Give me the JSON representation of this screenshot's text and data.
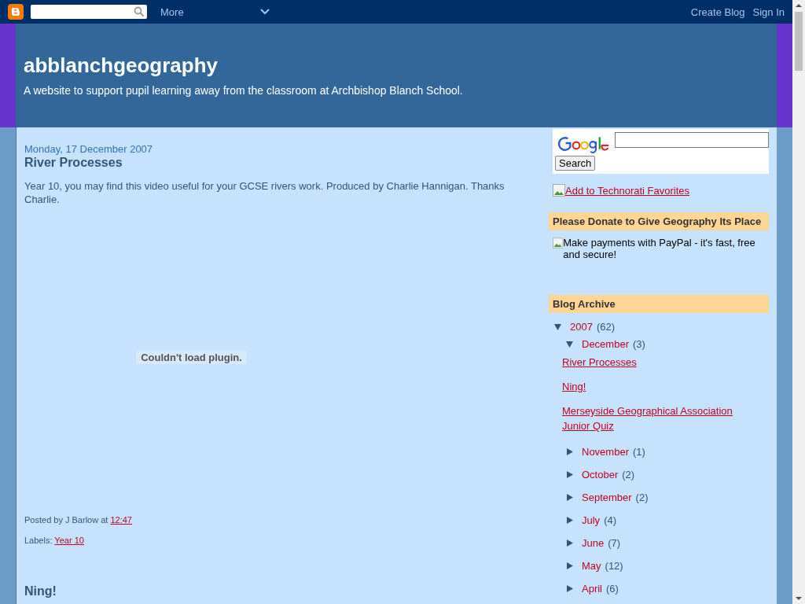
{
  "navbar": {
    "more_label": "More",
    "links": [
      "Create Blog",
      "Sign In"
    ]
  },
  "header": {
    "title": "abblanchgeography",
    "description": "A website to support pupil learning away from the classroom at Archbishop Blanch School."
  },
  "posts": [
    {
      "date": "Monday, 17 December 2007",
      "title": "River Processes",
      "body": "Year 10, you may find this video useful for your GCSE rivers work. Produced by Charlie Hannigan. Thanks Charlie.",
      "plugin_message": "Couldn't load plugin.",
      "posted_by": "Posted by J Barlow at",
      "time": "12:47",
      "labels_label": "Labels:",
      "labels": [
        "Year 10"
      ]
    },
    {
      "title": "Ning!"
    }
  ],
  "sidebar": {
    "search_button": "Search",
    "technorati_link": "Add to Technorati Favorites",
    "donate": {
      "title": "Please Donate to Give Geography Its Place",
      "image_alt": "Make payments with PayPal - it's fast, free and secure!"
    },
    "archive": {
      "title": "Blog Archive",
      "items": [
        {
          "label": "2007",
          "count": "(62)",
          "expanded": true,
          "children": [
            {
              "label": "December",
              "count": "(3)",
              "expanded": true,
              "posts": [
                "River Processes",
                "Ning!",
                "Merseyside Geographical Association Junior Quiz"
              ]
            },
            {
              "label": "November",
              "count": "(1)",
              "expanded": false
            },
            {
              "label": "October",
              "count": "(2)",
              "expanded": false
            },
            {
              "label": "September",
              "count": "(2)",
              "expanded": false
            },
            {
              "label": "July",
              "count": "(4)",
              "expanded": false
            },
            {
              "label": "June",
              "count": "(7)",
              "expanded": false
            },
            {
              "label": "May",
              "count": "(12)",
              "expanded": false
            },
            {
              "label": "April",
              "count": "(6)",
              "expanded": false
            }
          ]
        }
      ]
    }
  }
}
